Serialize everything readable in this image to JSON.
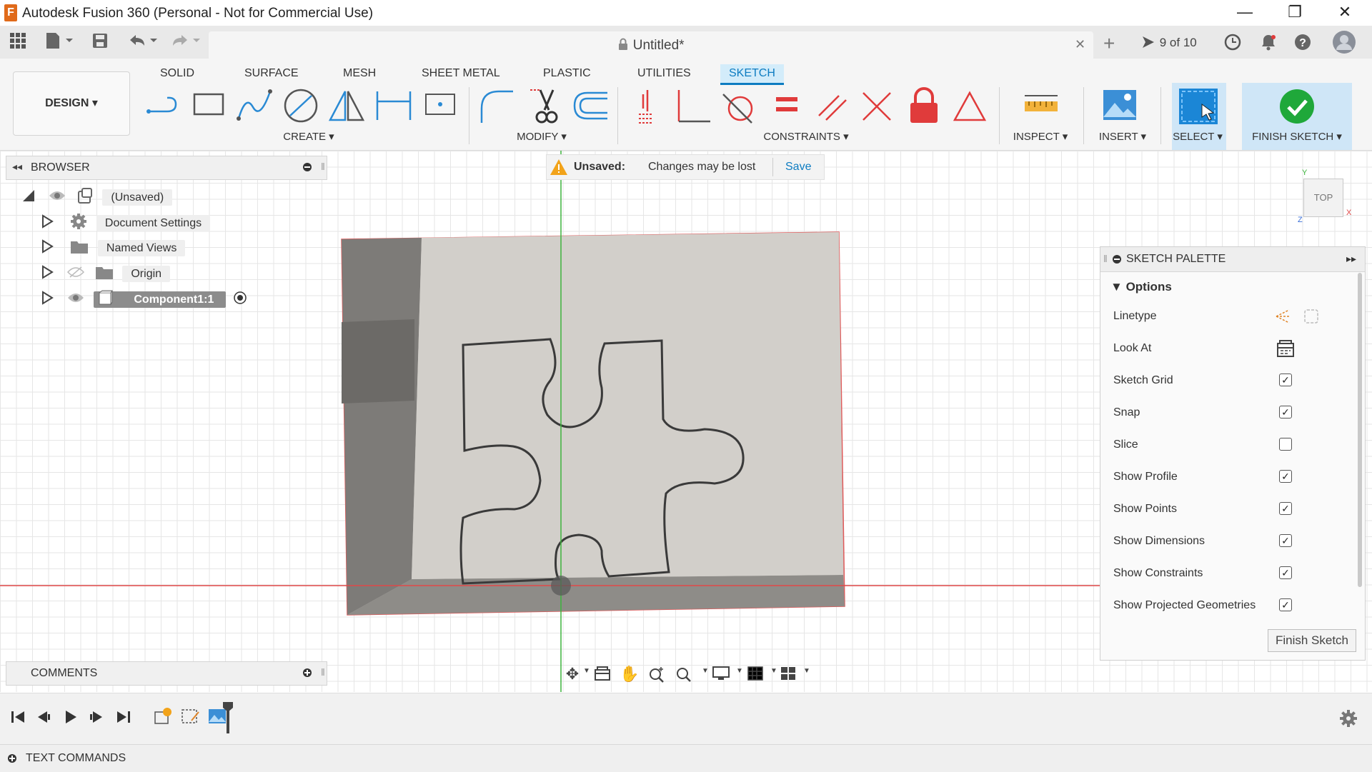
{
  "window": {
    "title": "Autodesk Fusion 360 (Personal - Not for Commercial Use)",
    "logo_letter": "F",
    "minimize": "—",
    "restore": "❐",
    "close": "✕"
  },
  "document": {
    "title": "Untitled*",
    "tab_close": "✕",
    "version_label": "9 of 10"
  },
  "ribbon": {
    "tabs": [
      "SOLID",
      "SURFACE",
      "MESH",
      "SHEET METAL",
      "PLASTIC",
      "UTILITIES",
      "SKETCH"
    ],
    "active_tab": "SKETCH",
    "workspace": "DESIGN ▾",
    "groups": {
      "create": "CREATE ▾",
      "modify": "MODIFY ▾",
      "constraints": "CONSTRAINTS ▾",
      "inspect": "INSPECT ▾",
      "insert": "INSERT ▾",
      "select": "SELECT ▾",
      "finish": "FINISH SKETCH ▾"
    }
  },
  "browser": {
    "title": "BROWSER",
    "root": "(Unsaved)",
    "items": [
      {
        "label": "Document Settings"
      },
      {
        "label": "Named Views"
      },
      {
        "label": "Origin"
      },
      {
        "label": "Component1:1"
      }
    ]
  },
  "banner": {
    "status": "Unsaved:",
    "message": "Changes may be lost",
    "save": "Save"
  },
  "viewcube": {
    "face": "TOP",
    "axis_y": "Y",
    "axis_x": "X",
    "axis_z": "Z"
  },
  "palette": {
    "title": "SKETCH PALETTE",
    "section": "Options",
    "options": [
      {
        "label": "Linetype",
        "type": "icons"
      },
      {
        "label": "Look At",
        "type": "icon"
      },
      {
        "label": "Sketch Grid",
        "checked": true
      },
      {
        "label": "Snap",
        "checked": true
      },
      {
        "label": "Slice",
        "checked": false
      },
      {
        "label": "Show Profile",
        "checked": true
      },
      {
        "label": "Show Points",
        "checked": true
      },
      {
        "label": "Show Dimensions",
        "checked": true
      },
      {
        "label": "Show Constraints",
        "checked": true
      },
      {
        "label": "Show Projected Geometries",
        "checked": true
      }
    ],
    "finish_button": "Finish Sketch"
  },
  "comments": {
    "title": "COMMENTS"
  },
  "text_commands": {
    "title": "TEXT COMMANDS"
  },
  "colors": {
    "accent": "#0d7cc1",
    "finish_green": "#1fa83a",
    "constraint_red": "#e03b3b",
    "axis_red": "#e04848",
    "axis_green": "#3db33d"
  }
}
